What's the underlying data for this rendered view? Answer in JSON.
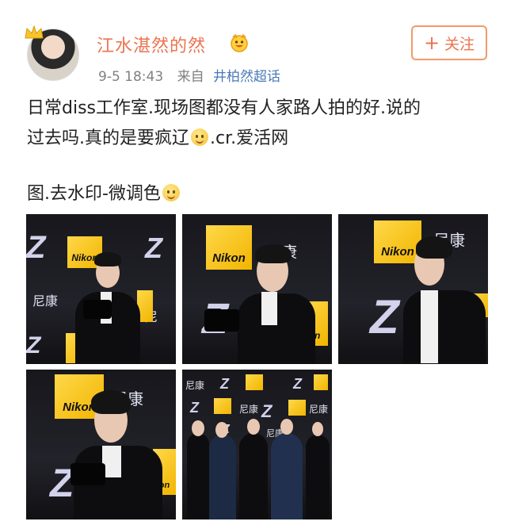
{
  "post": {
    "user_name": "江水湛然的然",
    "time": "9-5 18:43",
    "source_prefix": "来自",
    "source": "井柏然超话",
    "follow_label": "关注",
    "text_line1": "日常diss工作室.现场图都没有人家路人拍的好.说的",
    "text_line2_a": "过去吗.真的是要疯辽",
    "text_line2_b": ".cr.爱活网",
    "text_line3": "图.去水印-微调色"
  },
  "photos": [
    {
      "caption": "photo-1"
    },
    {
      "caption": "photo-2"
    },
    {
      "caption": "photo-3"
    },
    {
      "caption": "photo-4"
    },
    {
      "caption": "photo-5"
    }
  ],
  "colors": {
    "accent": "#eb7350",
    "link": "#4a79b8",
    "meta": "#808080",
    "nikon_yellow": "#f1b500"
  },
  "icons": [
    "crown-icon",
    "member-badge-icon",
    "plus-icon",
    "emoji-icon"
  ]
}
